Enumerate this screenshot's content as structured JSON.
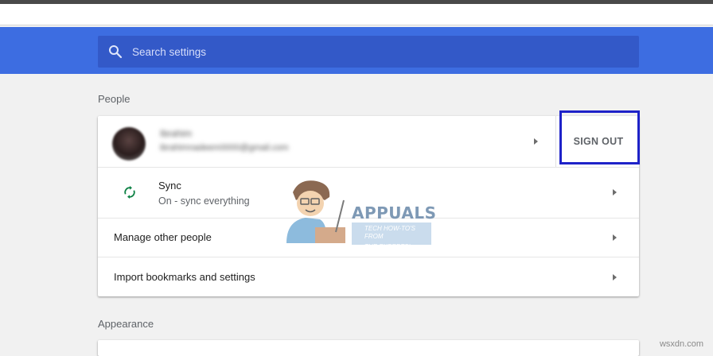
{
  "search": {
    "placeholder": "Search settings",
    "icon": "search-icon"
  },
  "people": {
    "title": "People",
    "account": {
      "name": "Ibrahim",
      "email": "ibrahimnadeem0000@gmail.com",
      "signout_label": "SIGN OUT"
    },
    "sync": {
      "title": "Sync",
      "status": "On - sync everything",
      "icon": "sync-icon",
      "icon_color": "#0b8043"
    },
    "manage_label": "Manage other people",
    "import_label": "Import bookmarks and settings"
  },
  "appearance": {
    "title": "Appearance"
  },
  "watermark": {
    "brand": "APPUALS",
    "tagline_1": "TECH HOW-TO'S FROM",
    "tagline_2": "THE EXPERTS!"
  },
  "site_credit": "wsxdn.com",
  "colors": {
    "header_blue": "#3d6de1",
    "search_bg": "#3359c8",
    "highlight_border": "#1e22c8"
  }
}
